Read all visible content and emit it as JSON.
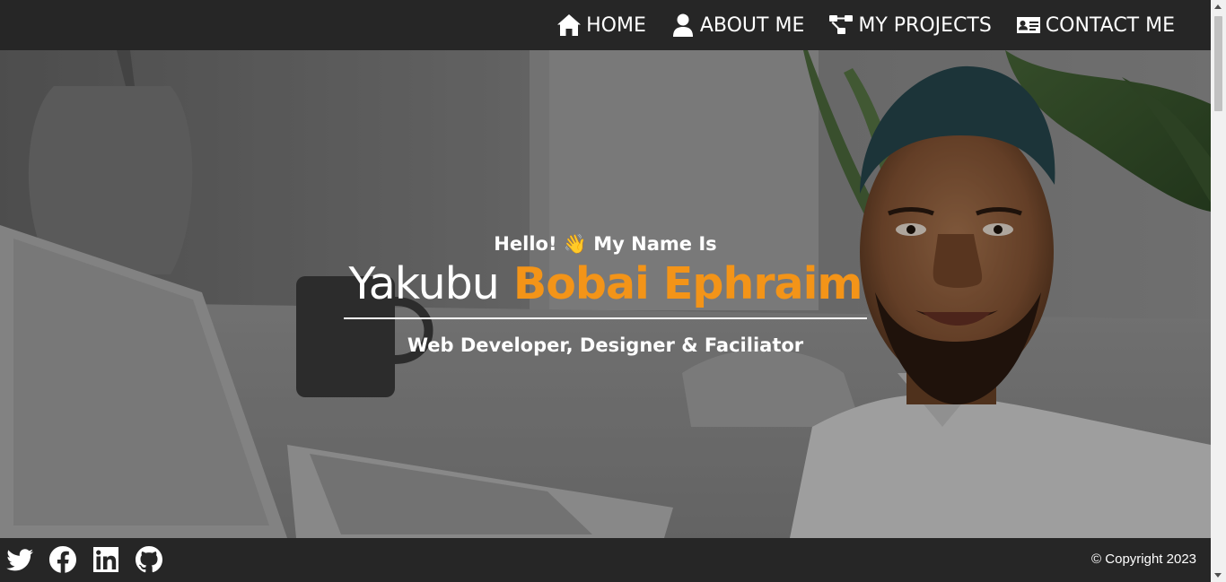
{
  "nav": {
    "items": [
      {
        "label": "HOME",
        "icon": "home-icon"
      },
      {
        "label": "ABOUT ME",
        "icon": "user-icon"
      },
      {
        "label": "MY PROJECTS",
        "icon": "project-diagram-icon"
      },
      {
        "label": "CONTACT ME",
        "icon": "address-card-icon"
      }
    ]
  },
  "hero": {
    "greeting": "Hello! 👋 My Name Is",
    "first_name": "Yakubu",
    "last_name": "Bobai Ephraim",
    "role": "Web Developer, Designer & Faciliator",
    "accent_color": "#f39418"
  },
  "footer": {
    "social": [
      {
        "icon": "twitter-icon"
      },
      {
        "icon": "facebook-icon"
      },
      {
        "icon": "linkedin-icon"
      },
      {
        "icon": "github-icon"
      }
    ],
    "copyright": "© Copyright 2023"
  },
  "colors": {
    "nav_bg": "#262626",
    "footer_bg": "#262626",
    "text": "#ffffff",
    "accent": "#f39418"
  }
}
